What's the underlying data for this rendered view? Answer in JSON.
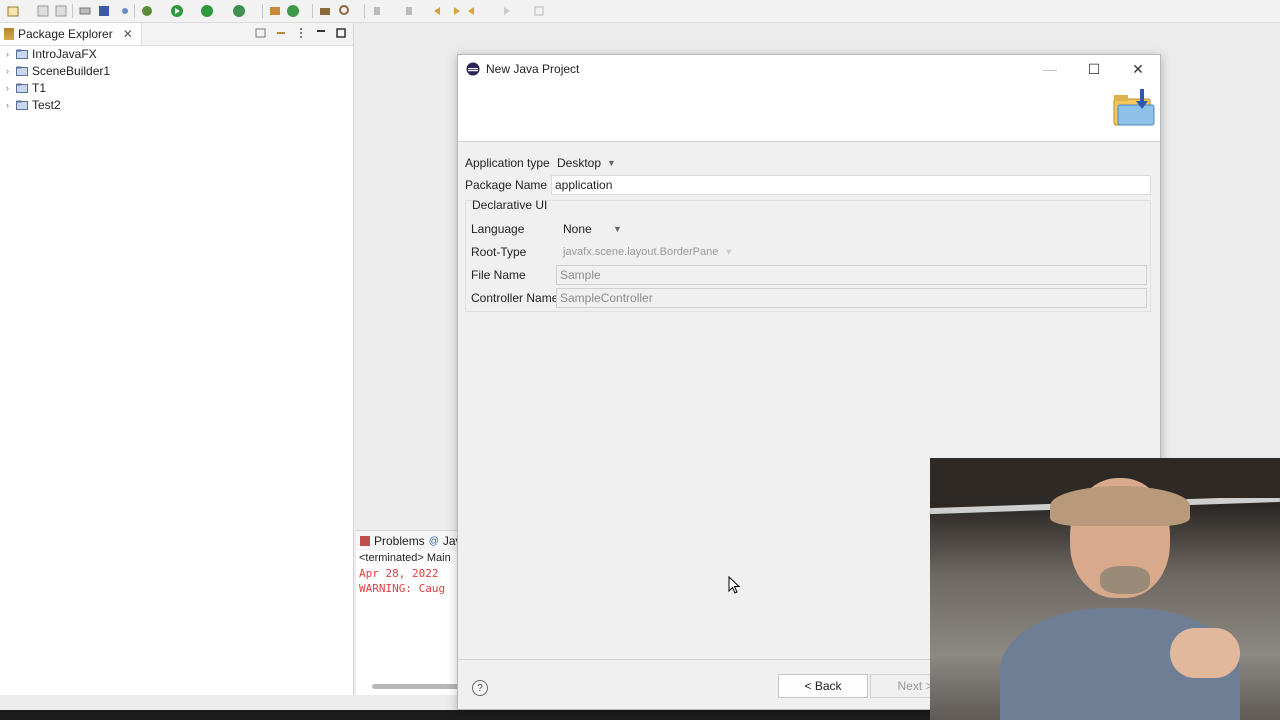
{
  "package_explorer": {
    "tab_title": "Package Explorer",
    "close_glyph": "✕",
    "projects": [
      {
        "label": "IntroJavaFX"
      },
      {
        "label": "SceneBuilder1"
      },
      {
        "label": "T1"
      },
      {
        "label": "Test2"
      }
    ]
  },
  "bottom_panel": {
    "tab_problems": "Problems",
    "tab_javadoc": "Jav",
    "status_line": "<terminated> Main",
    "console_lines": [
      "Apr 28, 2022 ",
      "WARNING: Caug"
    ]
  },
  "dialog": {
    "title": "New Java Project",
    "minimize_glyph": "—",
    "maximize_glyph": "☐",
    "close_glyph": "✕",
    "app_type_label": "Application type",
    "app_type_value": "Desktop",
    "package_name_label": "Package Name",
    "package_name_value": "application",
    "group_label": "Declarative UI",
    "language_label": "Language",
    "language_value": "None",
    "root_type_label": "Root-Type",
    "root_type_value": "javafx.scene.layout.BorderPane",
    "file_name_label": "File Name",
    "file_name_value": "Sample",
    "controller_name_label": "Controller Name",
    "controller_name_value": "SampleController",
    "help_glyph": "?",
    "back_label": "< Back",
    "next_label": "Next >"
  },
  "colors": {
    "console_text": "#e04040",
    "dialog_bg": "#f0f0f0",
    "accent_green": "#2e9a3e"
  }
}
